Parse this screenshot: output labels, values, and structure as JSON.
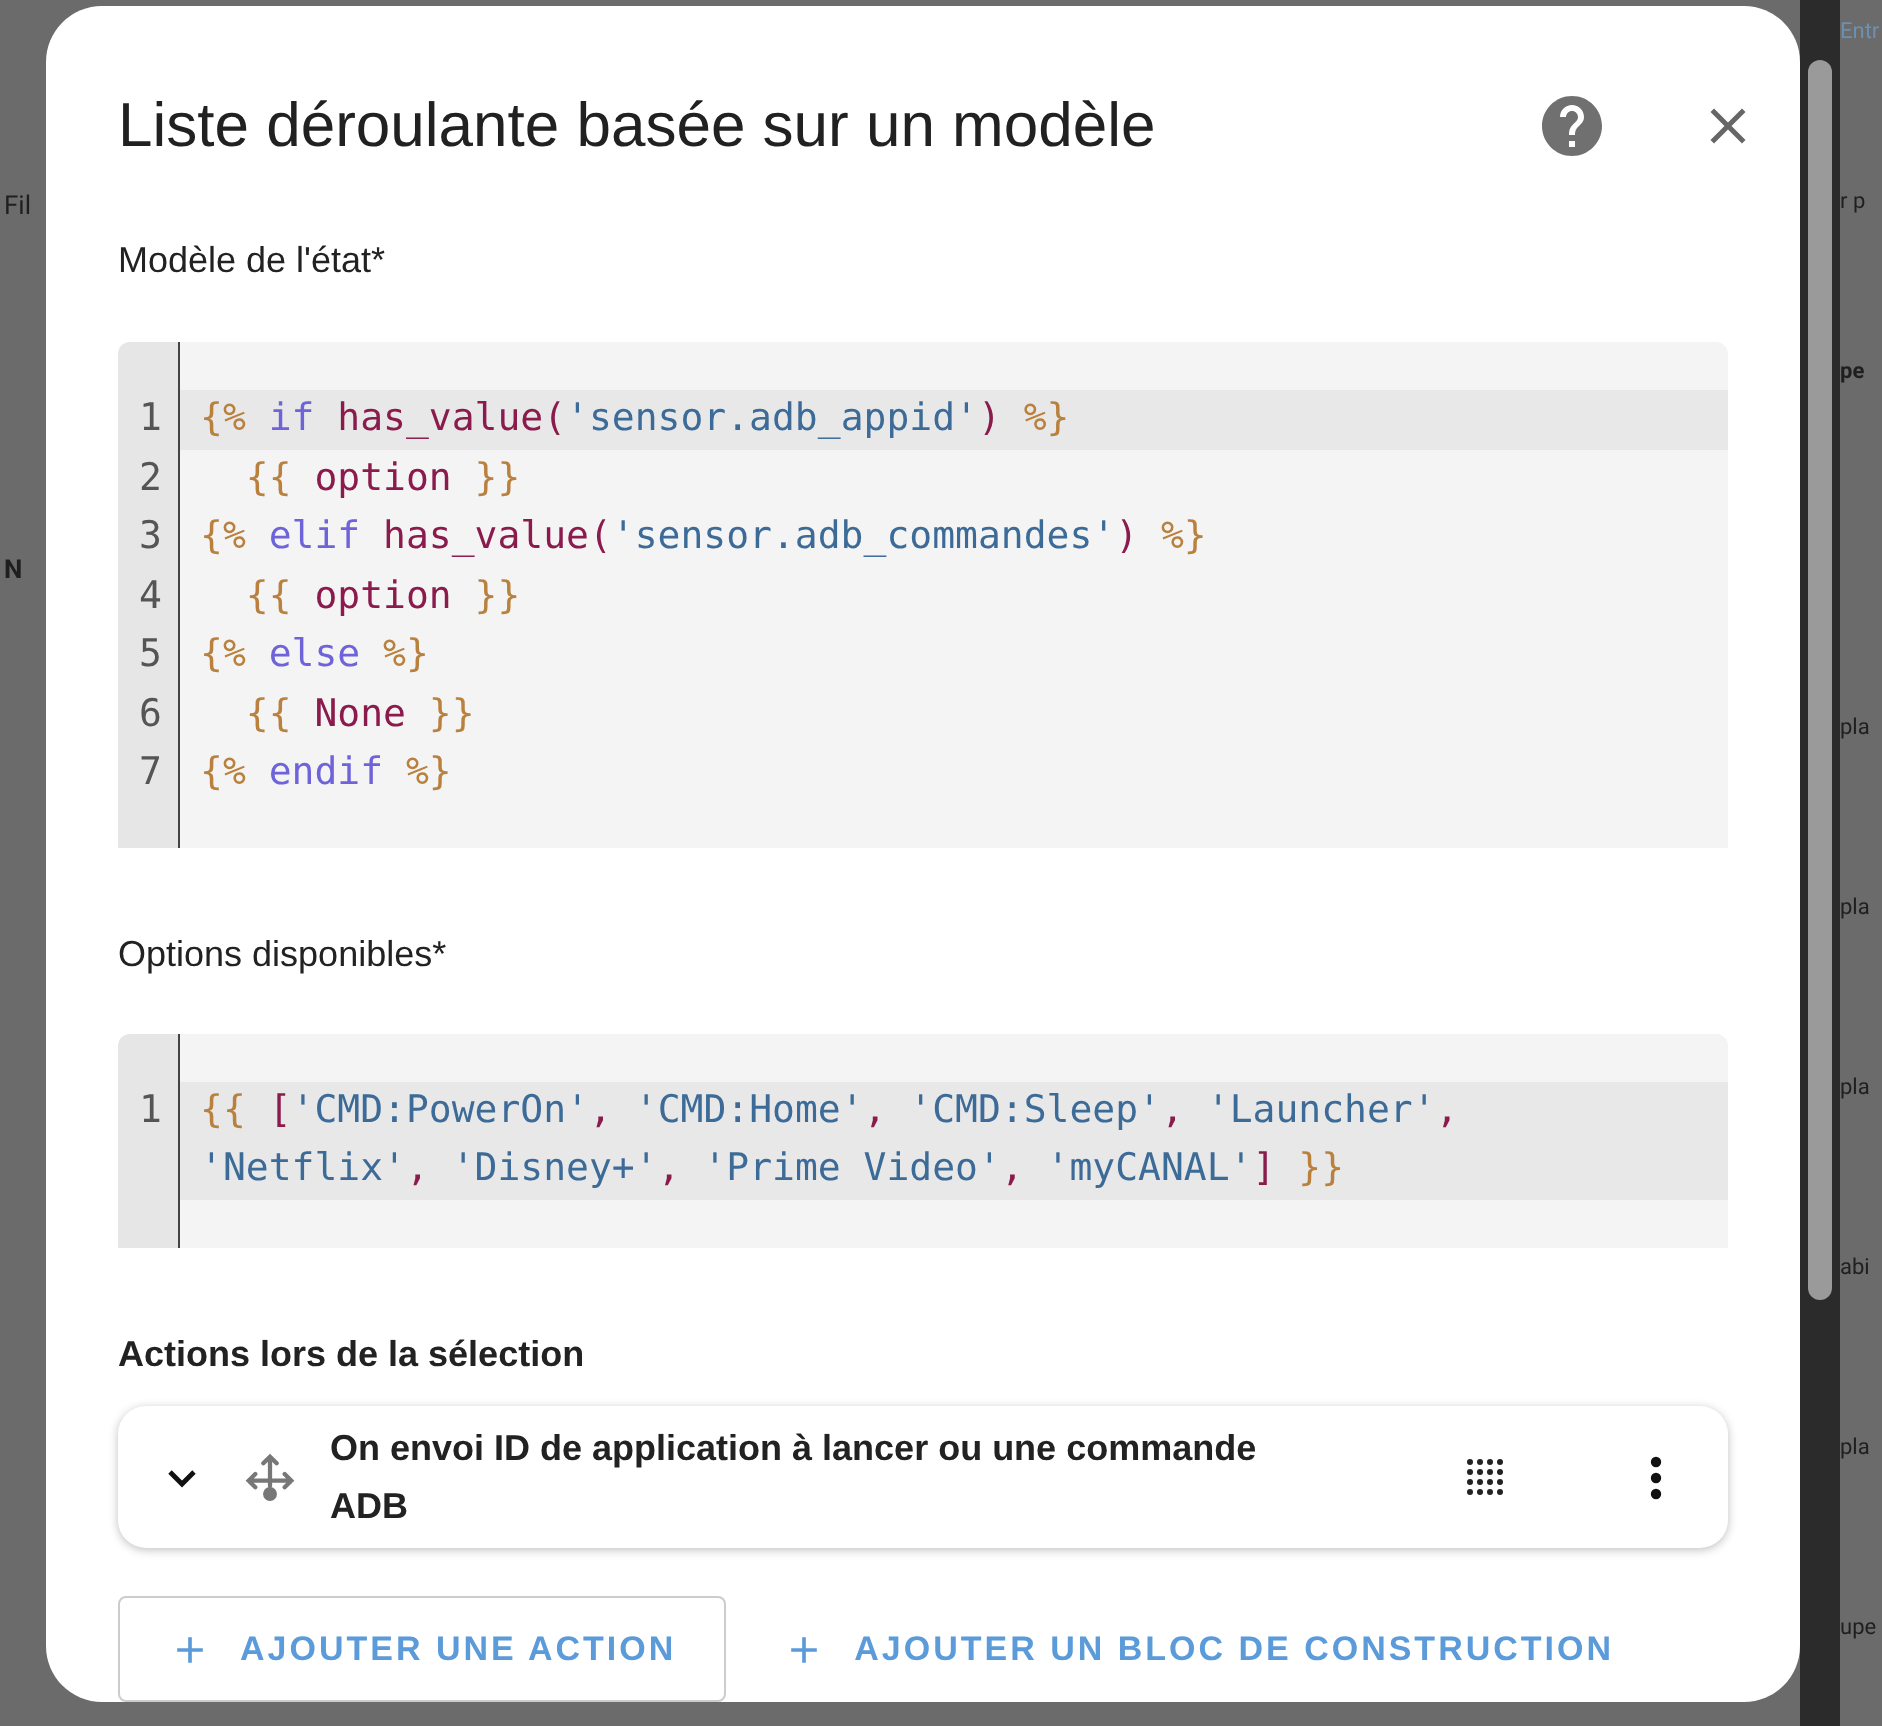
{
  "background": {
    "left": [
      "Fil",
      "N"
    ],
    "right": [
      {
        "text": "Entr",
        "kind": "tab"
      },
      {
        "text": "r p",
        "kind": "text"
      },
      {
        "text": "pe",
        "kind": "bold"
      },
      {
        "text": "pla",
        "kind": "text"
      },
      {
        "text": "pla",
        "kind": "text"
      },
      {
        "text": "pla",
        "kind": "text"
      },
      {
        "text": "abi",
        "kind": "text"
      },
      {
        "text": "pla",
        "kind": "text"
      },
      {
        "text": "upe",
        "kind": "text"
      }
    ]
  },
  "dialog": {
    "title": "Liste déroulante basée sur un modèle",
    "state_template": {
      "label": "Modèle de l'état*",
      "lines": [
        {
          "number": "1",
          "active": true,
          "tokens": [
            {
              "t": "{%",
              "kind": "delim"
            },
            {
              "t": " if ",
              "kind": "keyword"
            },
            {
              "t": "has_value(",
              "kind": "name"
            },
            {
              "t": "'sensor.adb_appid'",
              "kind": "string"
            },
            {
              "t": ") ",
              "kind": "name"
            },
            {
              "t": "%}",
              "kind": "delim"
            }
          ]
        },
        {
          "number": "2",
          "active": false,
          "tokens": [
            {
              "t": "  {{",
              "kind": "delim"
            },
            {
              "t": " option ",
              "kind": "name"
            },
            {
              "t": "}}",
              "kind": "delim"
            }
          ]
        },
        {
          "number": "3",
          "active": false,
          "tokens": [
            {
              "t": "{%",
              "kind": "delim"
            },
            {
              "t": " elif ",
              "kind": "keyword"
            },
            {
              "t": "has_value(",
              "kind": "name"
            },
            {
              "t": "'sensor.adb_commandes'",
              "kind": "string"
            },
            {
              "t": ") ",
              "kind": "name"
            },
            {
              "t": "%}",
              "kind": "delim"
            }
          ]
        },
        {
          "number": "4",
          "active": false,
          "tokens": [
            {
              "t": "  {{",
              "kind": "delim"
            },
            {
              "t": " option ",
              "kind": "name"
            },
            {
              "t": "}}",
              "kind": "delim"
            }
          ]
        },
        {
          "number": "5",
          "active": false,
          "tokens": [
            {
              "t": "{%",
              "kind": "delim"
            },
            {
              "t": " else ",
              "kind": "keyword"
            },
            {
              "t": "%}",
              "kind": "delim"
            }
          ]
        },
        {
          "number": "6",
          "active": false,
          "tokens": [
            {
              "t": "  {{",
              "kind": "delim"
            },
            {
              "t": " None ",
              "kind": "name"
            },
            {
              "t": "}}",
              "kind": "delim"
            }
          ]
        },
        {
          "number": "7",
          "active": false,
          "tokens": [
            {
              "t": "{%",
              "kind": "delim"
            },
            {
              "t": " endif ",
              "kind": "keyword"
            },
            {
              "t": "%}",
              "kind": "delim"
            }
          ]
        }
      ]
    },
    "options_template": {
      "label": "Options disponibles*",
      "lines": [
        {
          "number": "1",
          "active": true,
          "tokens": [
            {
              "t": "{{",
              "kind": "delim"
            },
            {
              "t": " [",
              "kind": "name"
            },
            {
              "t": "'CMD:PowerOn'",
              "kind": "string"
            },
            {
              "t": ", ",
              "kind": "name"
            },
            {
              "t": "'CMD:Home'",
              "kind": "string"
            },
            {
              "t": ", ",
              "kind": "name"
            },
            {
              "t": "'CMD:Sleep'",
              "kind": "string"
            },
            {
              "t": ", ",
              "kind": "name"
            },
            {
              "t": "'Launcher'",
              "kind": "string"
            },
            {
              "t": ", ",
              "kind": "name"
            },
            {
              "t": "'Netflix'",
              "kind": "string"
            },
            {
              "t": ", ",
              "kind": "name"
            },
            {
              "t": "'Disney+'",
              "kind": "string"
            },
            {
              "t": ", ",
              "kind": "name"
            },
            {
              "t": "'Prime Video'",
              "kind": "string"
            },
            {
              "t": ", ",
              "kind": "name"
            },
            {
              "t": "'myCANAL'",
              "kind": "string"
            },
            {
              "t": "] ",
              "kind": "name"
            },
            {
              "t": "}}",
              "kind": "delim"
            }
          ]
        }
      ]
    },
    "actions": {
      "label": "Actions lors de la sélection",
      "items": [
        {
          "title": "On envoi ID de application à lancer ou une commande ADB",
          "expanded": false
        }
      ]
    },
    "buttons": [
      {
        "label": "AJOUTER UNE ACTION",
        "kind": "outlined"
      },
      {
        "label": "AJOUTER UN BLOC DE CONSTRUCTION",
        "kind": "text"
      }
    ]
  }
}
